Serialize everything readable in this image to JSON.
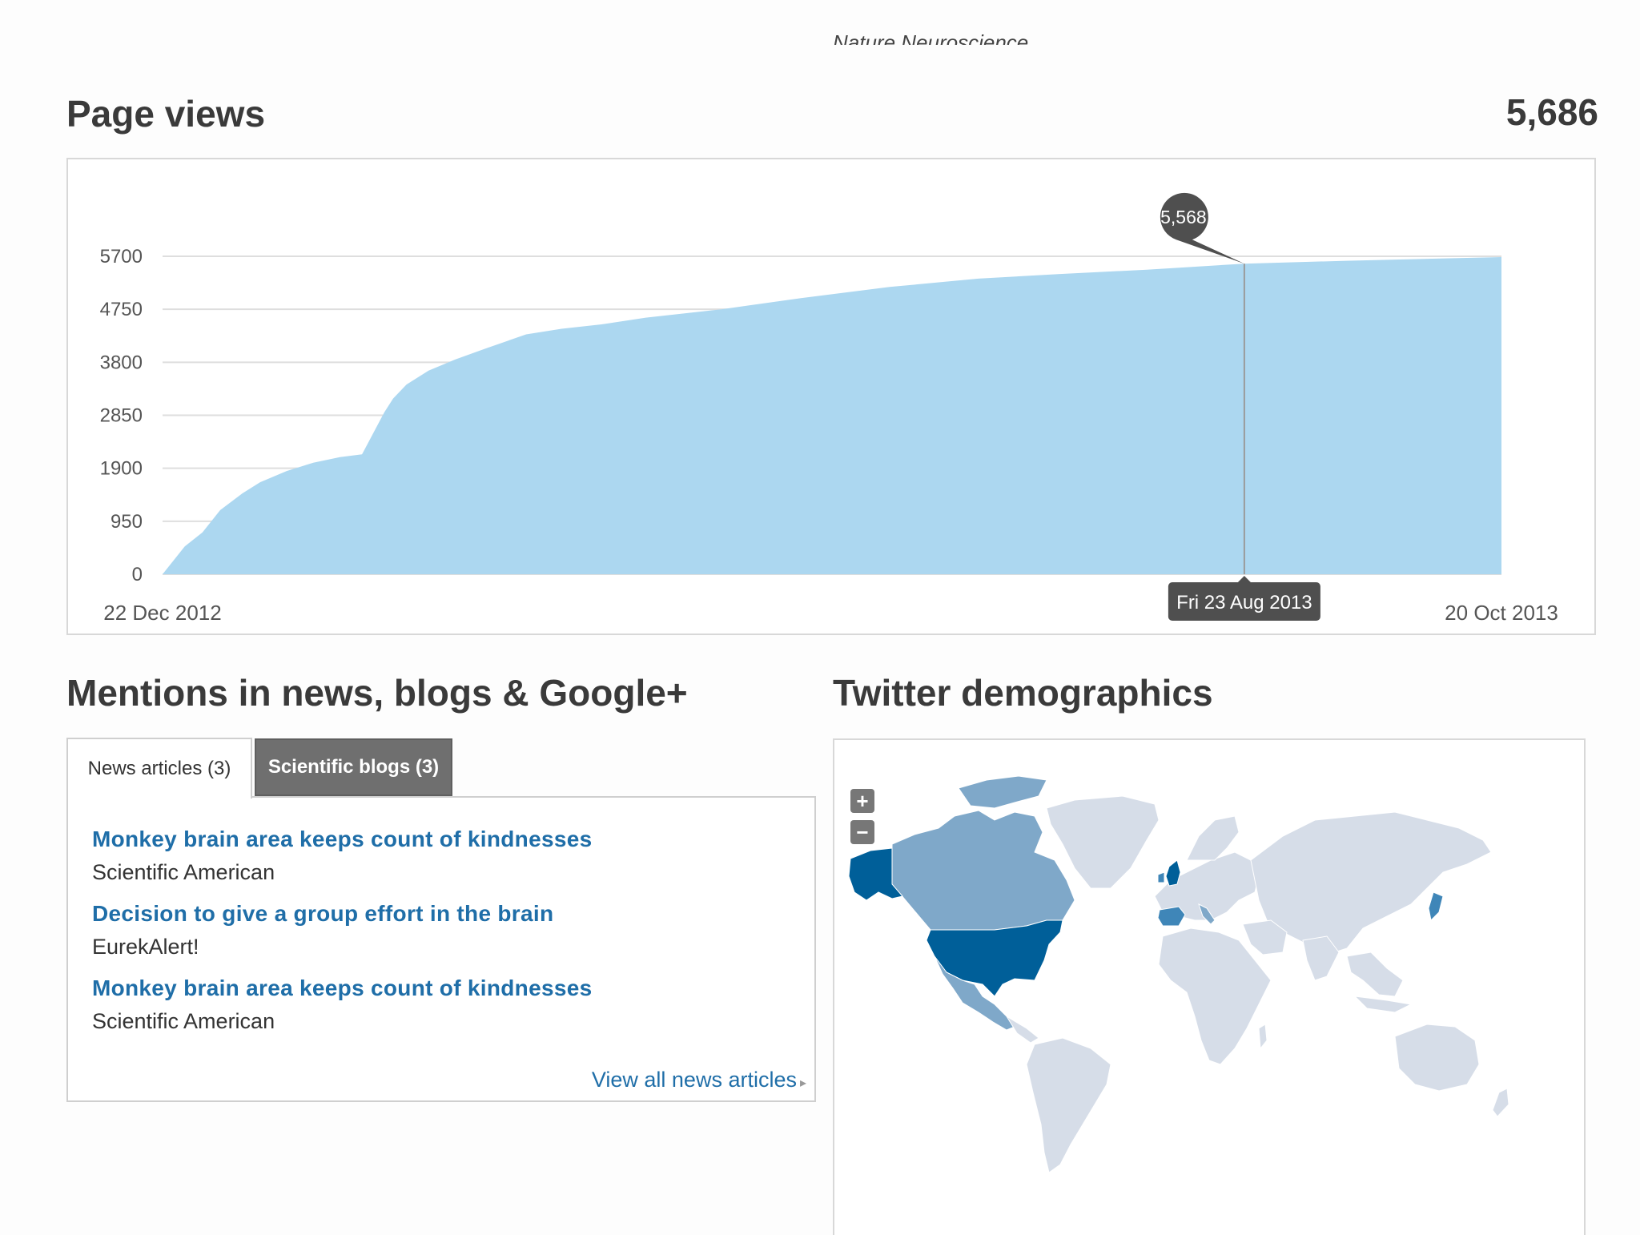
{
  "header": {
    "journal": "Nature Neuroscience"
  },
  "page_views": {
    "title": "Page views",
    "total": "5,686",
    "tooltip_value": "5,568",
    "tooltip_date": "Fri 23 Aug 2013",
    "start_label": "22 Dec 2012",
    "end_label": "20 Oct 2013"
  },
  "chart_data": {
    "type": "area",
    "title": "Page views",
    "x_start": "2012-12-22",
    "x_end": "2013-10-20",
    "y_ticks": [
      "0",
      "950",
      "1900",
      "2850",
      "3800",
      "4750",
      "5700"
    ],
    "ylim": [
      0,
      5700
    ],
    "grid": true,
    "color": "#acd7f0",
    "x": [
      "2012-12-22",
      "2012-12-27",
      "2012-12-31",
      "2013-01-04",
      "2013-01-09",
      "2013-01-13",
      "2013-01-19",
      "2013-01-25",
      "2013-01-31",
      "2013-02-05",
      "2013-02-10",
      "2013-02-12",
      "2013-02-15",
      "2013-02-20",
      "2013-02-26",
      "2013-03-05",
      "2013-03-14",
      "2013-03-22",
      "2013-03-31",
      "2013-04-10",
      "2013-04-27",
      "2013-05-15",
      "2013-06-04",
      "2013-06-24",
      "2013-07-12",
      "2013-08-01",
      "2013-08-23",
      "2013-09-15",
      "2013-10-20"
    ],
    "values": [
      0,
      500,
      750,
      1150,
      1450,
      1650,
      1850,
      2000,
      2100,
      2150,
      2900,
      3150,
      3400,
      3650,
      3850,
      4050,
      4300,
      4400,
      4480,
      4600,
      4750,
      4950,
      5150,
      5300,
      5380,
      5460,
      5568,
      5620,
      5686
    ],
    "highlight": {
      "date": "2013-08-23",
      "value": 5568
    }
  },
  "mentions": {
    "title": "Mentions in news, blogs & Google+",
    "tabs": [
      {
        "label": "News articles (3)",
        "active": true
      },
      {
        "label": "Scientific blogs (3)",
        "active": false
      }
    ],
    "items": [
      {
        "title": "Monkey brain area keeps count of kindnesses",
        "source": "Scientific American"
      },
      {
        "title": "Decision to give a group effort in the brain",
        "source": "EurekAlert!"
      },
      {
        "title": "Monkey brain area keeps count of kindnesses",
        "source": "Scientific American"
      }
    ],
    "view_all": "View all news articles"
  },
  "twitter": {
    "title": "Twitter demographics",
    "zoom_in": "+",
    "zoom_out": "−",
    "colors": {
      "base": "#d6dde8",
      "low": "#7fa8c9",
      "mid": "#3f86b8",
      "high": "#005f99"
    }
  }
}
